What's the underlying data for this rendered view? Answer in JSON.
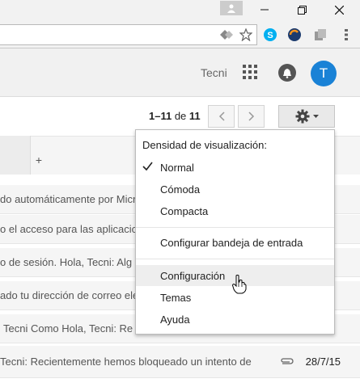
{
  "window": {
    "controls": [
      "minimize",
      "restore",
      "close"
    ]
  },
  "account": {
    "user_name": "Tecni",
    "avatar_letter": "T"
  },
  "pagination": {
    "range": "1–11",
    "of_label": "de",
    "total": "11"
  },
  "tab_bar": {
    "add_label": "+"
  },
  "emails": [
    {
      "text": "do automáticamente por Micr",
      "date": ""
    },
    {
      "text": "o el acceso para las aplicacion",
      "date": ""
    },
    {
      "text": "o de sesión. Hola, Tecni: Alg",
      "date": ""
    },
    {
      "text": "ado tu dirección de correo ele",
      "date": ""
    },
    {
      "text": "Tecni Como Hola, Tecni: Re",
      "date": ""
    },
    {
      "text": "Tecni: Recientemente hemos bloqueado un intento de",
      "date": "28/7/15",
      "has_attachment": true
    }
  ],
  "settings_menu": {
    "density_header": "Densidad de visualización:",
    "density_options": [
      {
        "label": "Normal",
        "checked": true
      },
      {
        "label": "Cómoda",
        "checked": false
      },
      {
        "label": "Compacta",
        "checked": false
      }
    ],
    "configure_inbox": "Configurar bandeja de entrada",
    "items": [
      {
        "label": "Configuración",
        "hovered": true
      },
      {
        "label": "Temas",
        "hovered": false
      },
      {
        "label": "Ayuda",
        "hovered": false
      }
    ]
  },
  "icons": {
    "check": "check-icon",
    "apps": "apps-grid-icon",
    "notifications": "bell-icon",
    "settings": "gear-icon",
    "prev": "chevron-left-icon",
    "next": "chevron-right-icon",
    "attachment": "paperclip-icon"
  },
  "colors": {
    "avatar": "#1a82d6",
    "menu_hover": "#eeeeee"
  }
}
